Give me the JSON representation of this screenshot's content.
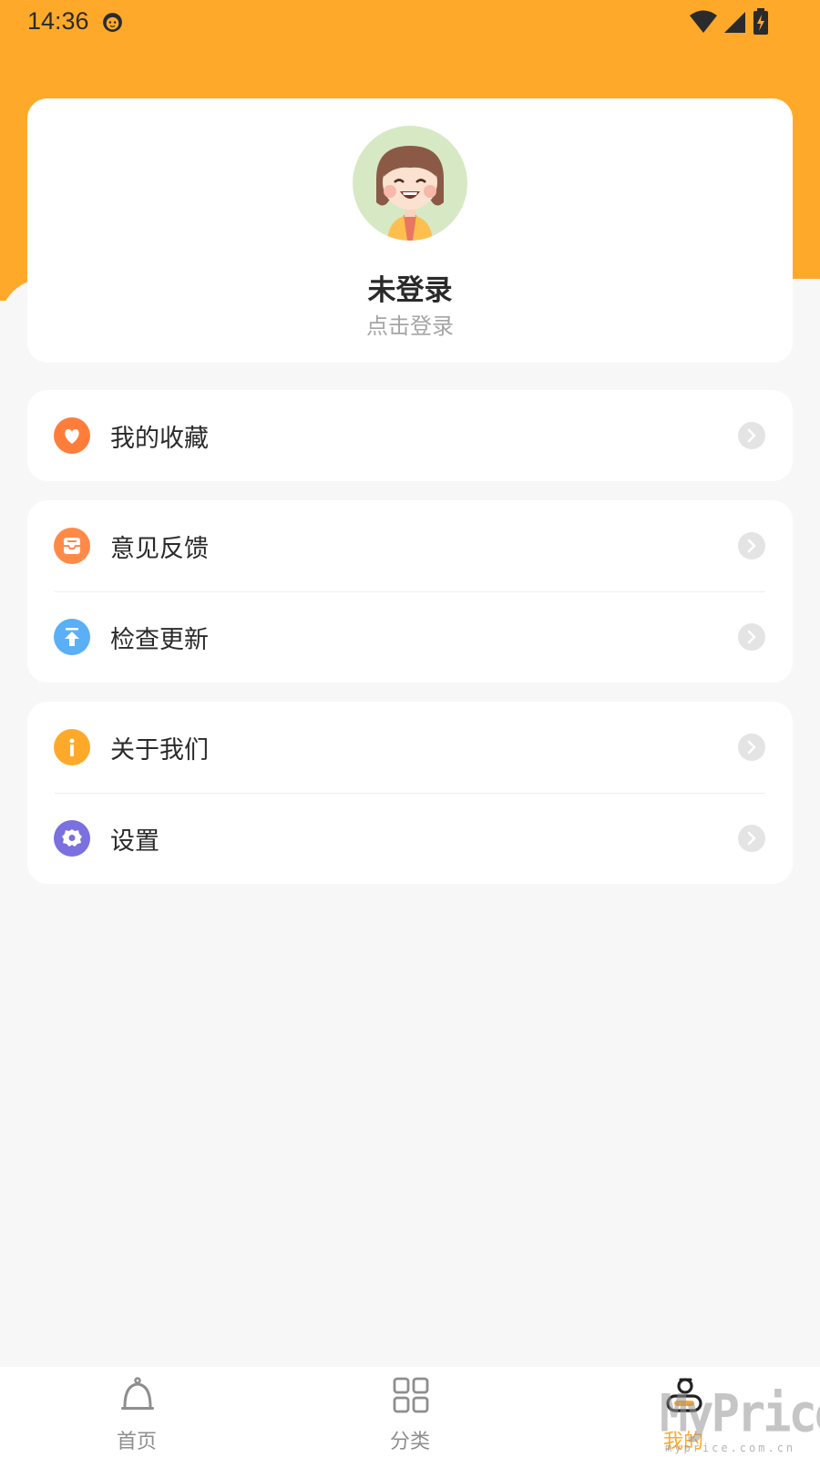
{
  "status_bar": {
    "time": "14:36"
  },
  "profile": {
    "name": "未登录",
    "subtitle": "点击登录"
  },
  "menu": {
    "favorites": {
      "label": "我的收藏",
      "icon": "heart-icon",
      "color": "#ff7d3b"
    },
    "feedback": {
      "label": "意见反馈",
      "icon": "mail-icon",
      "color": "#ff8a48"
    },
    "update": {
      "label": "检查更新",
      "icon": "upload-icon",
      "color": "#5aaff7"
    },
    "about": {
      "label": "关于我们",
      "icon": "info-icon",
      "color": "#ffa92b"
    },
    "settings": {
      "label": "设置",
      "icon": "gear-icon",
      "color": "#7a70e0"
    }
  },
  "tabs": [
    {
      "label": "首页",
      "icon": "bell-icon",
      "active": false
    },
    {
      "label": "分类",
      "icon": "grid-icon",
      "active": false
    },
    {
      "label": "我的",
      "icon": "profile-icon",
      "active": true
    }
  ],
  "watermark": {
    "brand": "MyPrice",
    "domain": "myprice.com.cn"
  },
  "colors": {
    "accent": "#ffa92b",
    "background": "#f7f7f7",
    "card": "#ffffff"
  }
}
